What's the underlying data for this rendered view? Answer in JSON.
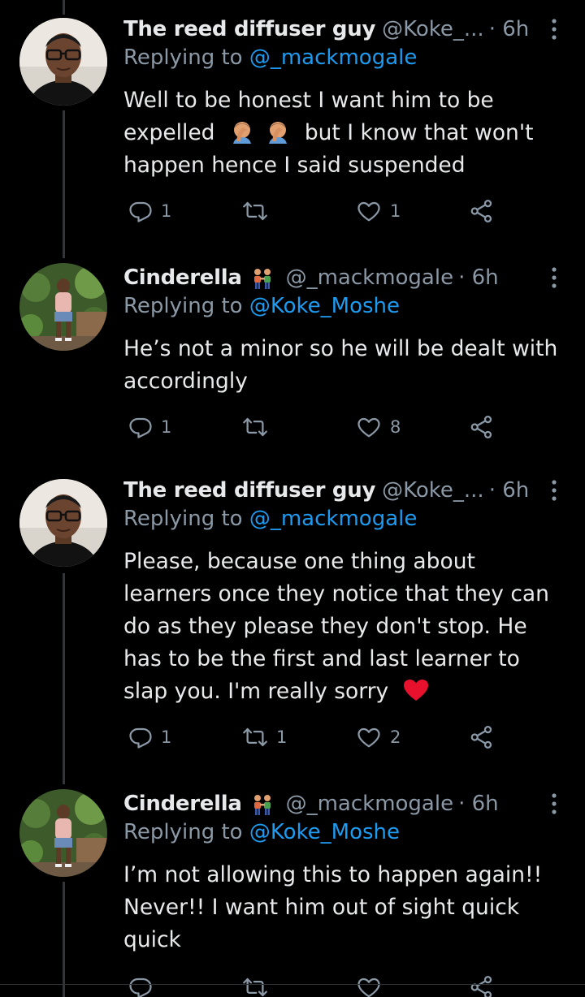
{
  "tweets": [
    {
      "name": "The reed diffuser guy",
      "handle": "@Koke_...",
      "time": "· 6h",
      "reply_label": "Replying to",
      "reply_to": "@_mackmogale",
      "text_lines": [
        "Well to be honest I want him to be",
        "expelled",
        "but I know that won't",
        "happen hence I said suspended"
      ],
      "replies": "1",
      "retweets": "",
      "likes": "1",
      "avatar": "man-glasses"
    },
    {
      "name": "Cinderella",
      "handle": "@_mackmogale",
      "time": "· 6h",
      "reply_label": "Replying to",
      "reply_to": "@Koke_Moshe",
      "text_lines": [
        "He’s not a minor so he will be dealt with",
        "accordingly"
      ],
      "replies": "1",
      "retweets": "",
      "likes": "8",
      "avatar": "woman-outdoor"
    },
    {
      "name": "The reed diffuser guy",
      "handle": "@Koke_...",
      "time": "· 6h",
      "reply_label": "Replying to",
      "reply_to": "@_mackmogale",
      "text_lines": [
        "Please, because one thing about",
        "learners once they notice that they can",
        "do as they please they don't stop. He",
        "has to be the first and last learner to",
        "slap you. I'm really sorry"
      ],
      "replies": "1",
      "retweets": "1",
      "likes": "2",
      "avatar": "man-glasses"
    },
    {
      "name": "Cinderella",
      "handle": "@_mackmogale",
      "time": "· 6h",
      "reply_label": "Replying to",
      "reply_to": "@Koke_Moshe",
      "text_lines": [
        "I’m not allowing this to happen again!!",
        "Never!! I want him out of sight quick",
        "quick"
      ],
      "replies": "",
      "retweets": "",
      "likes": "",
      "avatar": "woman-outdoor"
    }
  ],
  "icons": {
    "reply": "reply-icon",
    "retweet": "retweet-icon",
    "like": "heart-icon",
    "share": "share-icon",
    "more": "more-icon",
    "facepalm": "man-facepalming-emoji",
    "heart_emoji": "red-heart-emoji",
    "couple": "couple-emoji"
  },
  "colors": {
    "background": "#000000",
    "text": "#e7e9ea",
    "secondary": "#8b98a5",
    "link": "#1d9bf0",
    "heart": "#f91880"
  }
}
